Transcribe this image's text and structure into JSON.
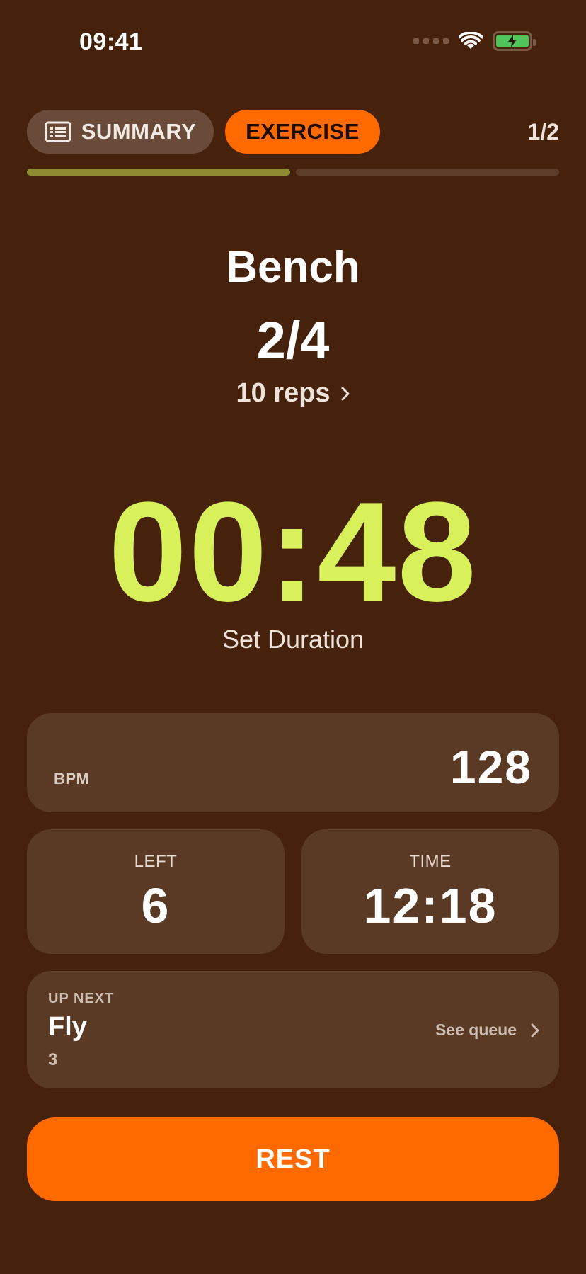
{
  "status_bar": {
    "time": "09:41",
    "icons": [
      "cellular-signal-icon",
      "wifi-icon",
      "battery-charging-icon"
    ],
    "battery_color": "#4FC45A"
  },
  "tabs": [
    {
      "label": "SUMMARY",
      "icon": "list-icon",
      "selected": false
    },
    {
      "label": "EXERCISE",
      "selected": true
    }
  ],
  "page_indicator": "1/2",
  "progress": {
    "segments": 2,
    "completed": 1
  },
  "exercise": {
    "name": "Bench",
    "set_counter": "2/4",
    "reps": "10 reps"
  },
  "timer": {
    "value": "00:48",
    "label": "Set Duration"
  },
  "stats": {
    "bpm": {
      "label": "BPM",
      "value": "128"
    },
    "left": {
      "label": "LEFT",
      "value": "6"
    },
    "time": {
      "label": "TIME",
      "value": "12:18"
    }
  },
  "up_next": {
    "label": "UP NEXT",
    "name": "Fly",
    "sets": "3",
    "link": "See queue"
  },
  "rest_button": "REST",
  "colors": {
    "background": "#46220C",
    "card": "#5A3A25",
    "accent": "#FF6A00",
    "timer": "#D8F05A",
    "progress_done": "#8F8B33"
  }
}
